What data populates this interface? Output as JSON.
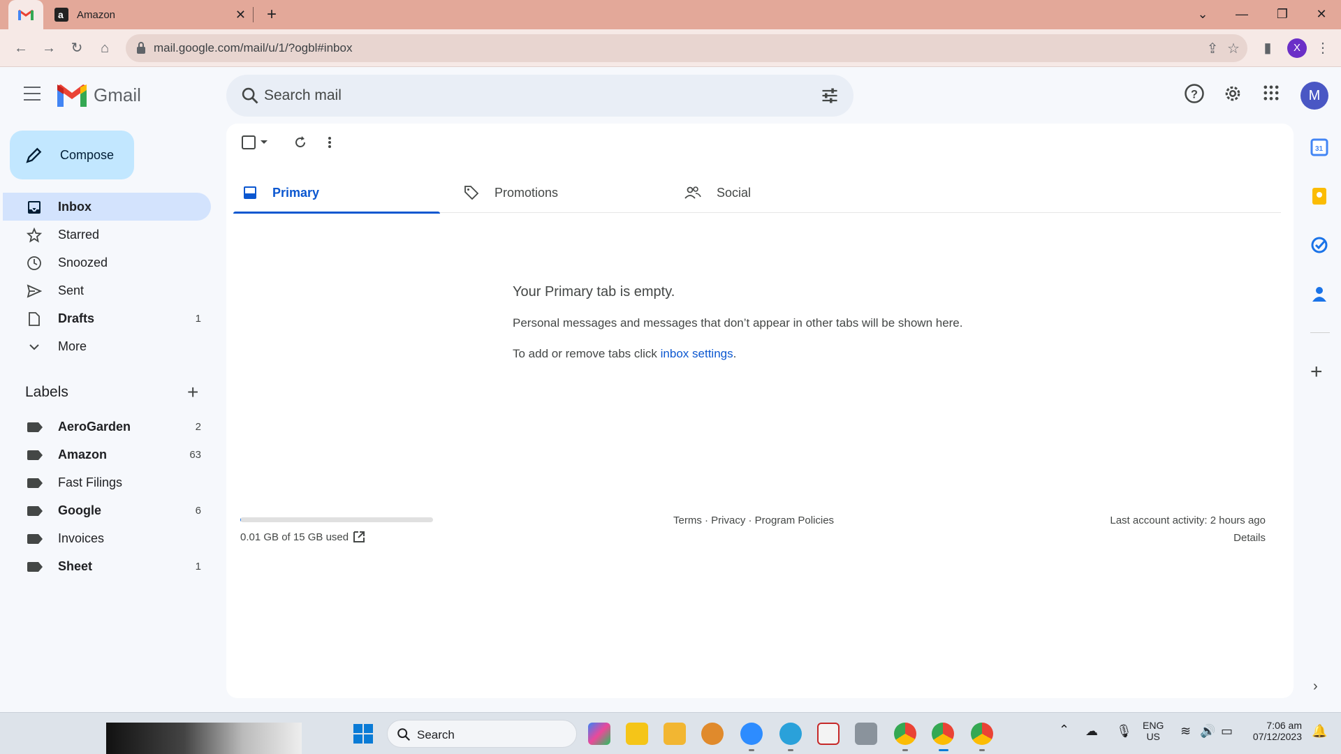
{
  "browser": {
    "tabs": [
      {
        "title": "",
        "icon": "gmail-icon"
      },
      {
        "title": "Amazon",
        "icon": "amazon-icon"
      }
    ],
    "url": "mail.google.com/mail/u/1/?ogbl#inbox",
    "profile_initial": "X"
  },
  "gmail": {
    "logo_text": "Gmail",
    "search_placeholder": "Search mail",
    "account_initial": "M",
    "compose_label": "Compose",
    "nav": [
      {
        "label": "Inbox",
        "count": "",
        "bold": true,
        "active": true,
        "icon": "inbox-icon"
      },
      {
        "label": "Starred",
        "count": "",
        "bold": false,
        "icon": "star-icon"
      },
      {
        "label": "Snoozed",
        "count": "",
        "bold": false,
        "icon": "clock-icon"
      },
      {
        "label": "Sent",
        "count": "",
        "bold": false,
        "icon": "send-icon"
      },
      {
        "label": "Drafts",
        "count": "1",
        "bold": true,
        "icon": "draft-icon"
      },
      {
        "label": "More",
        "count": "",
        "bold": false,
        "icon": "chevron-down-icon"
      }
    ],
    "labels_heading": "Labels",
    "labels": [
      {
        "label": "AeroGarden",
        "count": "2",
        "bold": true
      },
      {
        "label": "Amazon",
        "count": "63",
        "bold": true
      },
      {
        "label": "Fast Filings",
        "count": "",
        "bold": false
      },
      {
        "label": "Google",
        "count": "6",
        "bold": true
      },
      {
        "label": "Invoices",
        "count": "",
        "bold": false
      },
      {
        "label": "Sheet",
        "count": "1",
        "bold": true
      }
    ],
    "tabs": [
      {
        "label": "Primary",
        "active": true
      },
      {
        "label": "Promotions",
        "active": false
      },
      {
        "label": "Social",
        "active": false
      }
    ],
    "empty": {
      "title": "Your Primary tab is empty.",
      "description": "Personal messages and messages that don’t appear in other tabs will be shown here.",
      "hint_prefix": "To add or remove tabs click ",
      "hint_link": "inbox settings",
      "hint_suffix": "."
    },
    "footer": {
      "storage_text": "0.01 GB of 15 GB used",
      "storage_fraction": 0.001,
      "links": "Terms · Privacy · Program Policies",
      "last_activity": "Last account activity: 2 hours ago",
      "details": "Details"
    }
  },
  "taskbar": {
    "search_label": "Search",
    "lang_line1": "ENG",
    "lang_line2": "US",
    "time": "7:06 am",
    "date": "07/12/2023"
  },
  "colors": {
    "accent": "#0b57d0",
    "compose_bg": "#c2e7ff",
    "active_nav": "#d3e3fd",
    "tabstrip": "#e3a899"
  }
}
